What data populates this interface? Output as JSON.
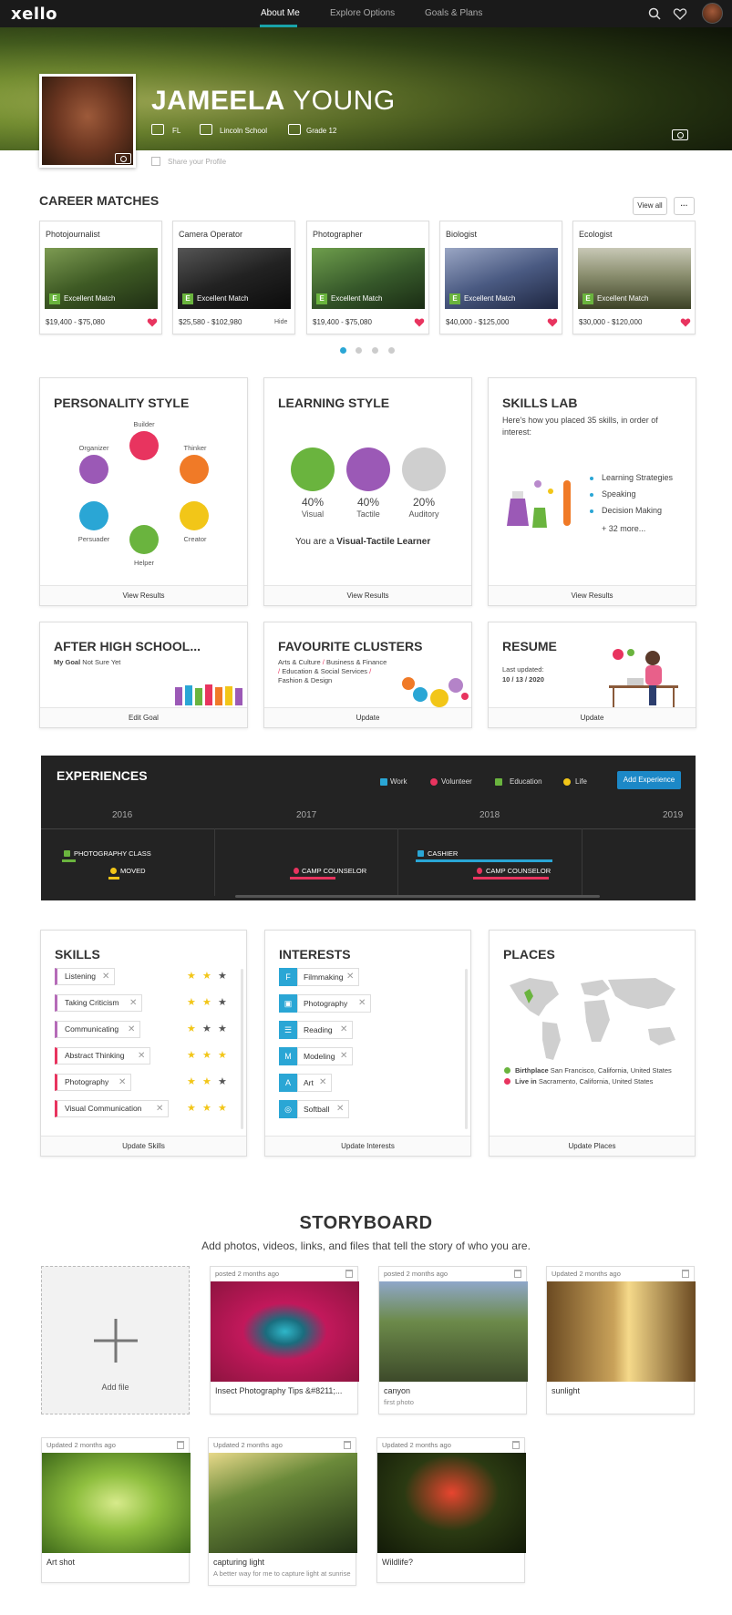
{
  "nav": {
    "logo": "xello",
    "tabs": [
      "About Me",
      "Explore Options",
      "Goals & Plans"
    ],
    "active_tab": "About Me"
  },
  "profile": {
    "first_name": "JAMEELA",
    "last_name": "YOUNG",
    "state": "FL",
    "school": "Lincoln School",
    "grade": "Grade 12",
    "share": "Share your Profile"
  },
  "career_matches": {
    "title": "CAREER MATCHES",
    "view_all": "View all",
    "more": "···",
    "badge": "E",
    "match_label": "Excellent Match",
    "hide_label": "Hide",
    "cards": [
      {
        "title": "Photojournalist",
        "salary": "$19,400 - $75,080"
      },
      {
        "title": "Camera Operator",
        "salary": "$25,580 - $102,980"
      },
      {
        "title": "Photographer",
        "salary": "$19,400 - $75,080"
      },
      {
        "title": "Biologist",
        "salary": "$40,000 - $125,000"
      },
      {
        "title": "Ecologist",
        "salary": "$30,000 - $120,000"
      }
    ]
  },
  "personality": {
    "title": "PERSONALITY STYLE",
    "labels": [
      "Builder",
      "Thinker",
      "Creator",
      "Helper",
      "Persuader",
      "Organizer"
    ],
    "footer": "View Results"
  },
  "learning": {
    "title": "LEARNING STYLE",
    "items": [
      {
        "pct": "40%",
        "label": "Visual"
      },
      {
        "pct": "40%",
        "label": "Tactile"
      },
      {
        "pct": "20%",
        "label": "Auditory"
      }
    ],
    "summary_prefix": "You are a ",
    "summary_bold": "Visual-Tactile Learner",
    "footer": "View Results"
  },
  "skills_lab": {
    "title": "SKILLS LAB",
    "desc": "Here's how you placed 35 skills, in order of interest:",
    "items": [
      "Learning Strategies",
      "Speaking",
      "Decision Making"
    ],
    "more": "+ 32 more...",
    "footer": "View Results"
  },
  "after_hs": {
    "title": "AFTER HIGH SCHOOL...",
    "goal_label": "My Goal",
    "goal_value": "Not Sure Yet",
    "footer": "Edit Goal"
  },
  "clusters": {
    "title": "FAVOURITE CLUSTERS",
    "items": [
      "Arts & Culture",
      "Business & Finance",
      "Education & Social Services",
      "Fashion & Design"
    ],
    "sep": "/",
    "footer": "Update"
  },
  "resume": {
    "title": "RESUME",
    "updated_label": "Last updated:",
    "updated_date": "10 / 13 / 2020",
    "footer": "Update"
  },
  "experiences": {
    "title": "EXPERIENCES",
    "legend": [
      "Work",
      "Volunteer",
      "Education",
      "Life"
    ],
    "add_button": "Add Experience",
    "years": [
      "2016",
      "2017",
      "2018",
      "2019"
    ],
    "items": [
      "PHOTOGRAPHY CLASS",
      "MOVED",
      "CAMP COUNSELOR",
      "CASHIER",
      "CAMP COUNSELOR"
    ],
    "colors": {
      "work": "#2aa6d5",
      "volunteer": "#e8345f",
      "education": "#6ab43e",
      "life": "#f2c618"
    }
  },
  "skills": {
    "title": "SKILLS",
    "items": [
      {
        "label": "Listening",
        "stars": 2
      },
      {
        "label": "Taking Criticism",
        "stars": 2
      },
      {
        "label": "Communicating",
        "stars": 1
      },
      {
        "label": "Abstract Thinking",
        "stars": 3
      },
      {
        "label": "Photography",
        "stars": 2
      },
      {
        "label": "Visual Communication",
        "stars": 3
      }
    ],
    "footer": "Update Skills"
  },
  "interests": {
    "title": "INTERESTS",
    "items": [
      {
        "icon": "F",
        "label": "Filmmaking"
      },
      {
        "icon": "camera-icon",
        "label": "Photography"
      },
      {
        "icon": "book-icon",
        "label": "Reading"
      },
      {
        "icon": "M",
        "label": "Modeling"
      },
      {
        "icon": "A",
        "label": "Art"
      },
      {
        "icon": "softball-icon",
        "label": "Softball"
      }
    ],
    "footer": "Update Interests"
  },
  "places": {
    "title": "PLACES",
    "birthplace_label": "Birthplace",
    "birthplace": "San Francisco, California, United States",
    "live_label": "Live in",
    "live": "Sacramento, California, United States",
    "footer": "Update Places"
  },
  "storyboard": {
    "title": "STORYBOARD",
    "subtitle": "Add photos, videos, links, and files that tell the story of who you are.",
    "add_label": "Add file",
    "cards": [
      {
        "meta": "posted 2 months ago",
        "caption": "Insect Photography Tips &#8211;...",
        "sub": ""
      },
      {
        "meta": "posted 2 months ago",
        "caption": "canyon",
        "sub": "first photo"
      },
      {
        "meta": "Updated 2 months ago",
        "caption": "sunlight",
        "sub": ""
      },
      {
        "meta": "Updated 2 months ago",
        "caption": "Art shot",
        "sub": ""
      },
      {
        "meta": "Updated 2 months ago",
        "caption": "capturing light",
        "sub": "A better way for me to capture light at sunrise"
      },
      {
        "meta": "Updated 2 months ago",
        "caption": "Wildlife?",
        "sub": ""
      }
    ]
  }
}
